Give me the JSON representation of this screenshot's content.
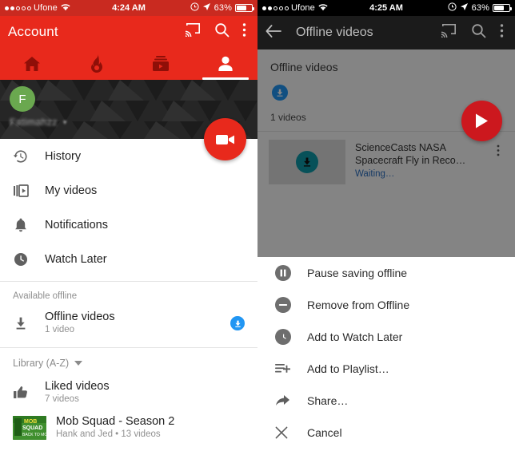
{
  "left": {
    "status": {
      "carrier": "Ufone",
      "time": "4:24 AM",
      "battery": "63%"
    },
    "appbar": {
      "title": "Account"
    },
    "tabs": [
      {
        "name": "home",
        "icon": "home-icon",
        "active": false
      },
      {
        "name": "trending",
        "icon": "flame-icon",
        "active": false
      },
      {
        "name": "subscriptions",
        "icon": "subscriptions-icon",
        "active": false
      },
      {
        "name": "account",
        "icon": "person-icon",
        "active": true
      }
    ],
    "profile": {
      "initial": "F",
      "username": "Fatimahzz",
      "caret": "▾"
    },
    "menu": [
      {
        "label": "History",
        "icon": "history-icon"
      },
      {
        "label": "My videos",
        "icon": "my-videos-icon"
      },
      {
        "label": "Notifications",
        "icon": "bell-icon"
      },
      {
        "label": "Watch Later",
        "icon": "clock-icon"
      }
    ],
    "offline_section": {
      "header": "Available offline",
      "title": "Offline videos",
      "subtitle": "1 video",
      "badge": "download-badge"
    },
    "library": {
      "header": "Library (A-Z)",
      "items": [
        {
          "title": "Liked videos",
          "subtitle": "7 videos",
          "icon": "thumb-up-icon"
        },
        {
          "title": "Mob Squad - Season 2",
          "subtitle": "Hank and Jed • 13 videos",
          "icon": "playlist-thumbnail"
        }
      ]
    },
    "fab": "record-video-button"
  },
  "right": {
    "status": {
      "carrier": "Ufone",
      "time": "4:25 AM",
      "battery": "63%"
    },
    "appbar": {
      "title": "Offline videos",
      "back": "back-arrow"
    },
    "page_header": "Offline videos",
    "count": "1 videos",
    "video": {
      "title": "ScienceCasts  NASA Spacecraft Fly in Reco…",
      "status": "Waiting…"
    },
    "fab": "play-button",
    "sheet": [
      {
        "label": "Pause saving offline",
        "icon": "pause-icon"
      },
      {
        "label": "Remove from Offline",
        "icon": "minus-icon"
      },
      {
        "label": "Add to Watch Later",
        "icon": "clock-icon"
      },
      {
        "label": "Add to Playlist…",
        "icon": "playlist-add-icon"
      },
      {
        "label": "Share…",
        "icon": "share-icon"
      },
      {
        "label": "Cancel",
        "icon": "close-icon"
      }
    ]
  },
  "colors": {
    "brand_red": "#e8291c",
    "fab_red": "#cc181e",
    "blue": "#2196f3",
    "dark": "#1b1b1b"
  }
}
